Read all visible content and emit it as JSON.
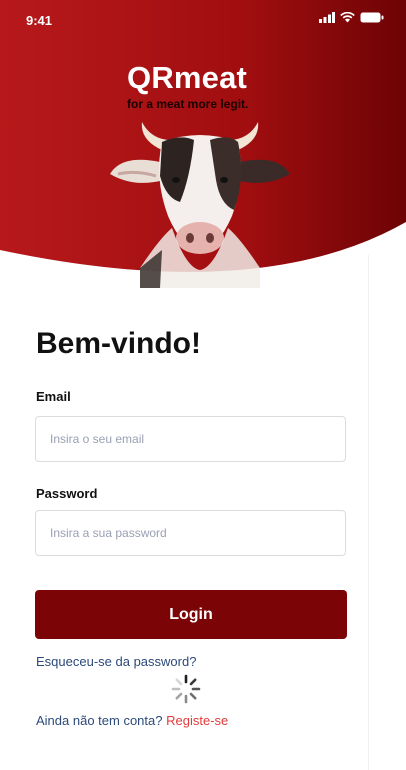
{
  "status_bar": {
    "time": "9:41",
    "icons": [
      "signal-icon",
      "wifi-icon",
      "battery-icon"
    ]
  },
  "header": {
    "brand": "QRmeat",
    "tagline": "for a meat more legit.",
    "colors": {
      "gradient_start": "#b7191b",
      "gradient_end": "#6d0304"
    }
  },
  "form": {
    "title": "Bem-vindo!",
    "email_label": "Email",
    "email_placeholder": "Insira o seu email",
    "email_value": "",
    "password_label": "Password",
    "password_placeholder": "Insira a sua password",
    "password_value": "",
    "login_label": "Login",
    "forgot_label": "Esqueceu-se da password?",
    "no_account_text": "Ainda não tem conta?",
    "register_label": "Registe-se"
  },
  "colors": {
    "button": "#7a0406",
    "link": "#2c4a7a",
    "register_link": "#e23b3b"
  }
}
